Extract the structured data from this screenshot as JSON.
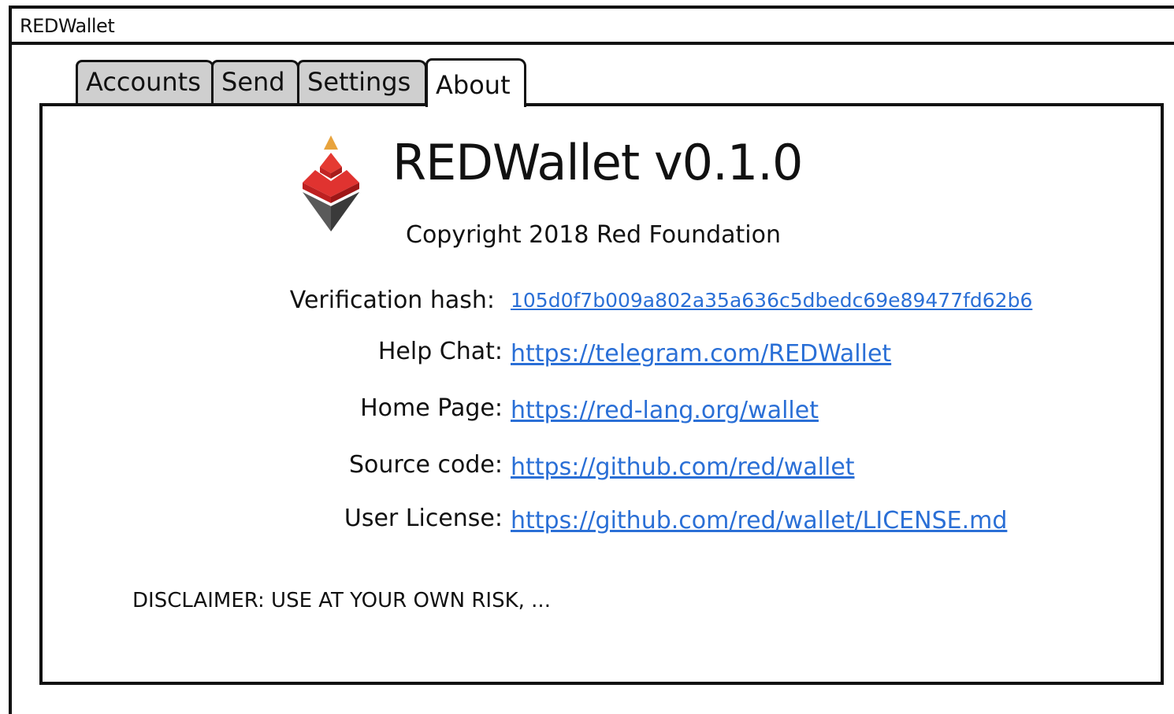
{
  "window": {
    "title": "REDWallet"
  },
  "tabs": [
    {
      "label": "Accounts",
      "active": false
    },
    {
      "label": "Send",
      "active": false
    },
    {
      "label": "Settings",
      "active": false
    },
    {
      "label": "About",
      "active": true
    }
  ],
  "about": {
    "app_title": "REDWallet v0.1.0",
    "copyright": "Copyright 2018 Red Foundation",
    "rows": [
      {
        "label": "Verification hash:",
        "value": "105d0f7b009a802a35a636c5dbedc69e89477fd62b6"
      },
      {
        "label": "Help Chat:",
        "value": "https://telegram.com/REDWallet"
      },
      {
        "label": "Home Page:",
        "value": "https://red-lang.org/wallet"
      },
      {
        "label": "Source code:",
        "value": "https://github.com/red/wallet"
      },
      {
        "label": "User License:",
        "value": "https://github.com/red/wallet/LICENSE.md"
      }
    ],
    "disclaimer": "DISCLAIMER: USE AT YOUR OWN RISK, ..."
  },
  "colors": {
    "link": "#2a6fd6",
    "tab_inactive": "#cfcfcf",
    "logo_red": "#d62a2a",
    "logo_orange": "#e8a33d",
    "logo_gray": "#555555"
  },
  "icons": {
    "logo": "red-pyramid-logo-icon"
  }
}
